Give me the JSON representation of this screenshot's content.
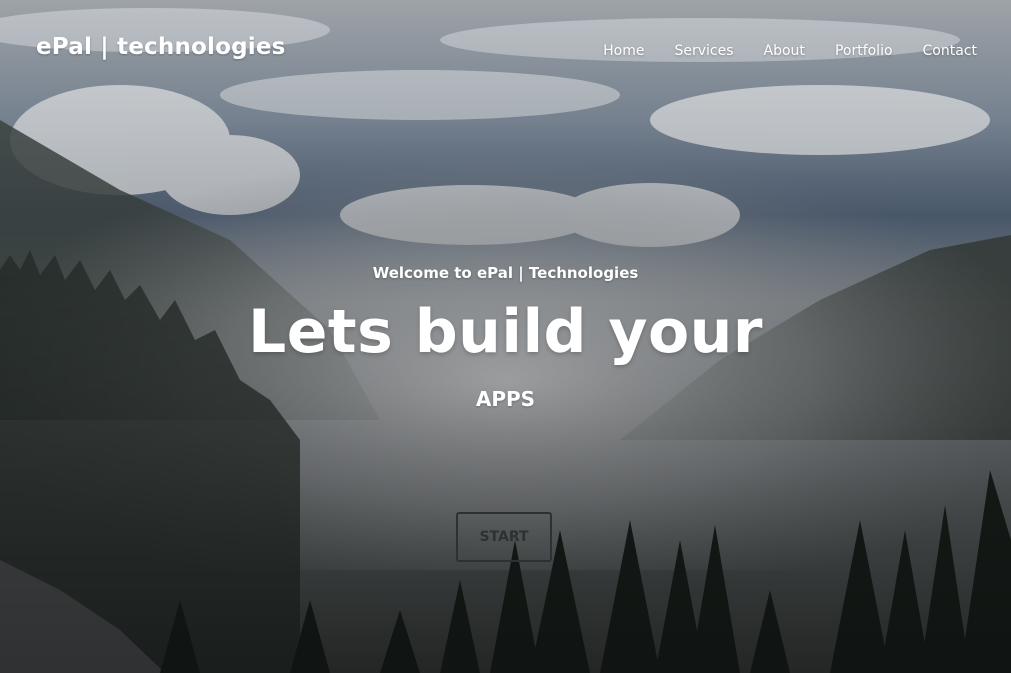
{
  "header": {
    "brand": "ePal | technologies",
    "nav": [
      {
        "label": "Home"
      },
      {
        "label": "Services"
      },
      {
        "label": "About"
      },
      {
        "label": "Portfolio"
      },
      {
        "label": "Contact"
      }
    ]
  },
  "hero": {
    "subtitle": "Welcome to ePal | Technologies",
    "headline": "Lets build your",
    "tagline": "APPS",
    "cta_label": "START"
  },
  "colors": {
    "text": "#ffffff",
    "button_border": "#2e3134",
    "sky": "#4a5f78",
    "fog": "#c8cacc",
    "forest": "#1e2622"
  }
}
